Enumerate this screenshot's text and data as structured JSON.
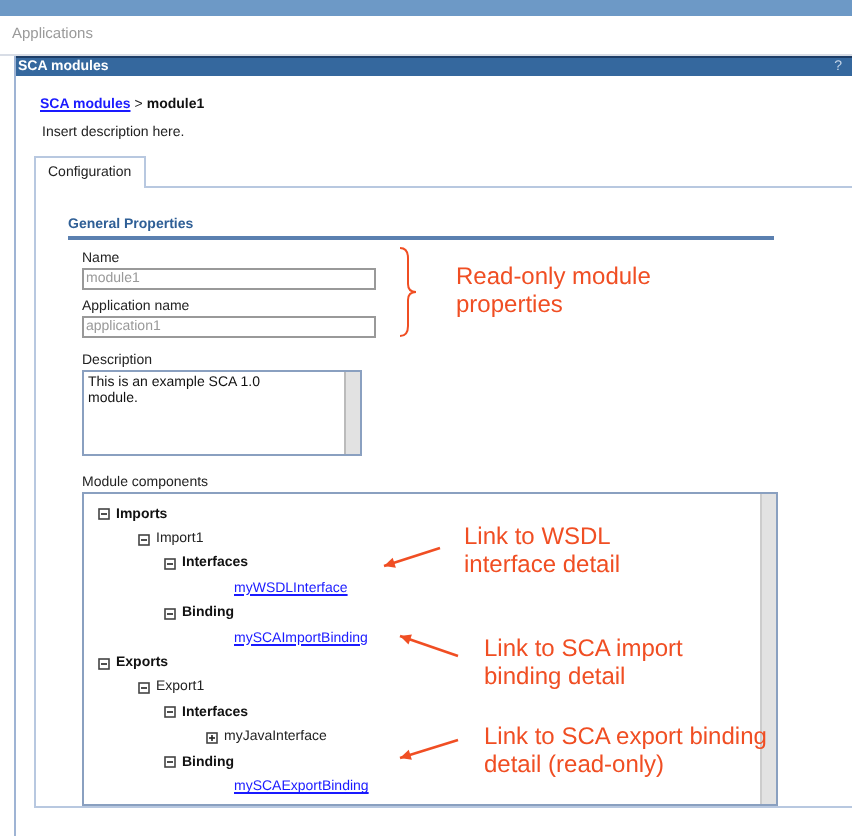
{
  "header": {
    "title": "Applications"
  },
  "panel": {
    "title": "SCA modules",
    "help": "?"
  },
  "breadcrumb": {
    "link": "SCA modules",
    "separator": ">",
    "current": "module1"
  },
  "description": "Insert description here.",
  "tabs": [
    {
      "label": "Configuration",
      "selected": true
    }
  ],
  "section_title": "General Properties",
  "fields": [
    {
      "label": "Name",
      "value": "module1",
      "disabled": true
    },
    {
      "label": "Application name",
      "value": "application1",
      "disabled": true
    }
  ],
  "description_field": {
    "label": "Description",
    "value": "This is an example SCA 1.0 module."
  },
  "components": {
    "label": "Module components",
    "tree": [
      {
        "label": "Imports",
        "kind": "category",
        "expanded": true,
        "children": [
          {
            "label": "Import1",
            "kind": "item",
            "expanded": true,
            "children": [
              {
                "label": "Interfaces",
                "kind": "category",
                "expanded": true,
                "children": [
                  {
                    "label": "myWSDLInterface",
                    "kind": "link"
                  }
                ]
              },
              {
                "label": "Binding",
                "kind": "category",
                "expanded": true,
                "children": [
                  {
                    "label": "mySCAImportBinding",
                    "kind": "link"
                  }
                ]
              }
            ]
          }
        ]
      },
      {
        "label": "Exports",
        "kind": "category",
        "expanded": true,
        "children": [
          {
            "label": "Export1",
            "kind": "item",
            "expanded": true,
            "children": [
              {
                "label": "Interfaces",
                "kind": "category",
                "expanded": true,
                "children": [
                  {
                    "label": "myJavaInterface",
                    "kind": "item",
                    "expanded": false
                  }
                ]
              },
              {
                "label": "Binding",
                "kind": "category",
                "expanded": true,
                "children": [
                  {
                    "label": "mySCAExportBinding",
                    "kind": "link"
                  }
                ]
              }
            ]
          }
        ]
      }
    ]
  },
  "annotations": [
    {
      "text": "Read-only module properties",
      "kind": "brace"
    },
    {
      "text": "Link to WSDL interface detail",
      "kind": "arrow"
    },
    {
      "text": "Link to SCA import binding detail",
      "kind": "arrow"
    },
    {
      "text": "Link to SCA export binding detail (read-only)",
      "kind": "arrow"
    }
  ]
}
